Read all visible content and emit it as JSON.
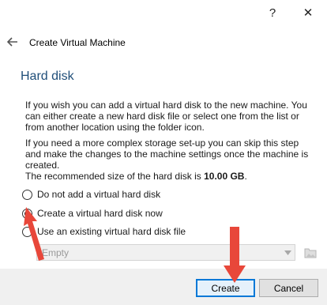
{
  "window": {
    "help_label": "?",
    "close_label": "✕"
  },
  "nav": {
    "back_icon": "back-arrow-icon",
    "title": "Create Virtual Machine"
  },
  "page": {
    "heading": "Hard disk",
    "paragraph1": "If you wish you can add a virtual hard disk to the new machine. You can either create a new hard disk file or select one from the list or from another location using the folder icon.",
    "paragraph2": "If you need a more complex storage set-up you can skip this step and make the changes to the machine settings once the machine is created.",
    "recommended_prefix": "The recommended size of the hard disk is ",
    "recommended_size": "10.00 GB",
    "recommended_suffix": "."
  },
  "options": [
    {
      "label": "Do not add a virtual hard disk",
      "checked": false
    },
    {
      "label": "Create a virtual hard disk now",
      "checked": true
    },
    {
      "label": "Use an existing virtual hard disk file",
      "checked": false
    }
  ],
  "existing_disk": {
    "selected": "Empty",
    "enabled": false
  },
  "buttons": {
    "create": "Create",
    "cancel": "Cancel"
  },
  "colors": {
    "heading": "#1f4e79",
    "annotation_arrow": "#e8473a",
    "default_button_border": "#0078d7"
  }
}
